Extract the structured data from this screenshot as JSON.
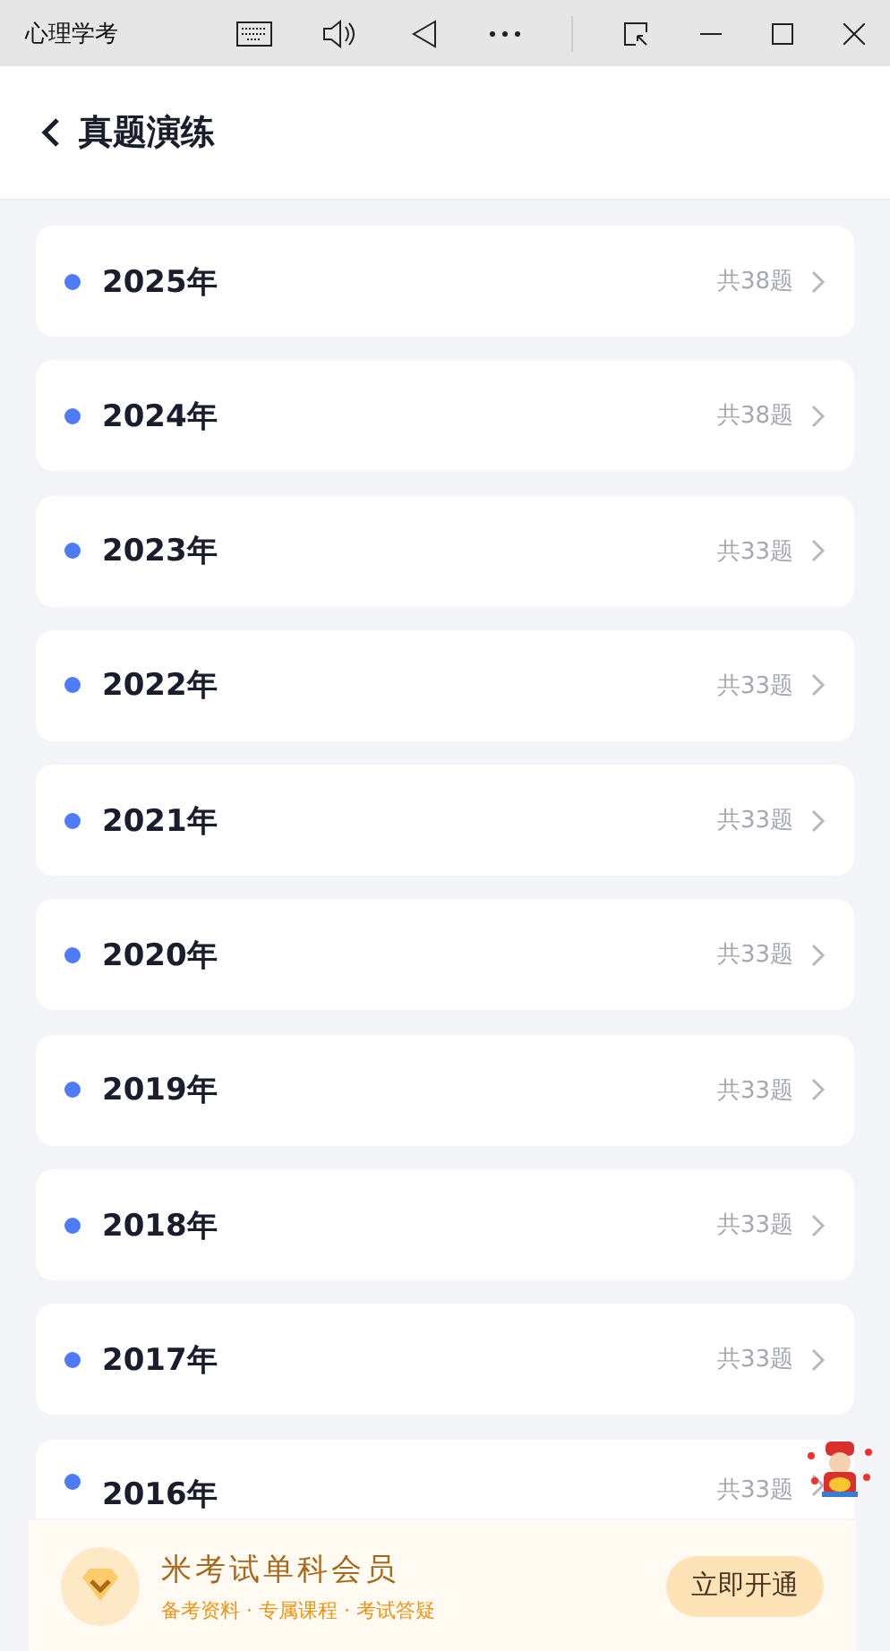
{
  "window": {
    "title": "心理学考"
  },
  "header": {
    "title": "真题演练"
  },
  "years": [
    {
      "label": "2025年",
      "count": "共38题"
    },
    {
      "label": "2024年",
      "count": "共38题"
    },
    {
      "label": "2023年",
      "count": "共33题"
    },
    {
      "label": "2022年",
      "count": "共33题"
    },
    {
      "label": "2021年",
      "count": "共33题"
    },
    {
      "label": "2020年",
      "count": "共33题"
    },
    {
      "label": "2019年",
      "count": "共33题"
    },
    {
      "label": "2018年",
      "count": "共33题"
    },
    {
      "label": "2017年",
      "count": "共33题"
    },
    {
      "label": "2016年",
      "count": "共33题"
    }
  ],
  "banner": {
    "title": "米考试单科会员",
    "subtitle": "备考资料 · 专属课程 · 考试答疑",
    "button": "立即开通"
  }
}
